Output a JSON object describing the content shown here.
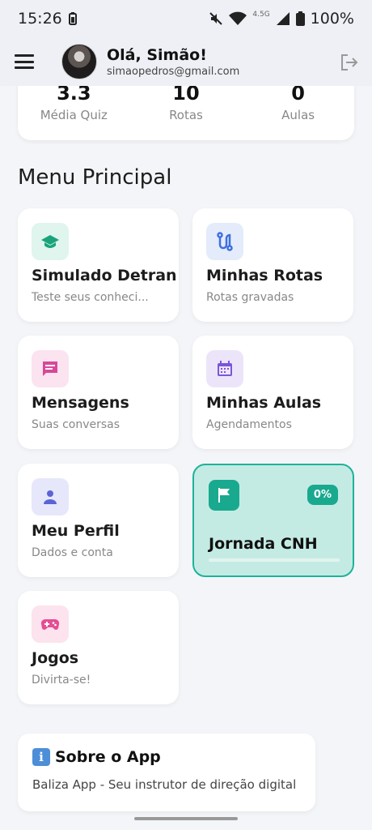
{
  "status_bar": {
    "time": "15:26",
    "network": "4.5G",
    "battery": "100%"
  },
  "header": {
    "greeting": "Olá, Simão!",
    "email": "simaopedros@gmail.com"
  },
  "stats": [
    {
      "value": "3.3",
      "label": "Média Quiz"
    },
    {
      "value": "10",
      "label": "Rotas"
    },
    {
      "value": "0",
      "label": "Aulas"
    }
  ],
  "section_title": "Menu Principal",
  "cards": [
    {
      "title": "Simulado Detran",
      "sub": "Teste seus conheci...",
      "icon": "graduation-cap-icon",
      "color": "#1aa37a",
      "bg": "#dff5ee"
    },
    {
      "title": "Minhas Rotas",
      "sub": "Rotas gravadas",
      "icon": "route-icon",
      "color": "#3f6fe0",
      "bg": "#e4ecfb"
    },
    {
      "title": "Mensagens",
      "sub": "Suas conversas",
      "icon": "message-icon",
      "color": "#d7489a",
      "bg": "#fbe3f0"
    },
    {
      "title": "Minhas Aulas",
      "sub": "Agendamentos",
      "icon": "calendar-icon",
      "color": "#7c56d8",
      "bg": "#ece5fa"
    },
    {
      "title": "Meu Perfil",
      "sub": "Dados e conta",
      "icon": "person-icon",
      "color": "#5a64d6",
      "bg": "#e6e7fb"
    },
    {
      "title": "Jogos",
      "sub": "Divirta-se!",
      "icon": "gamepad-icon",
      "color": "#e44e93",
      "bg": "#fce3ee"
    }
  ],
  "jornada": {
    "title": "Jornada CNH",
    "percent": "0%",
    "progress": 0
  },
  "about": {
    "title": "Sobre o App",
    "subtitle": "Baliza App - Seu instrutor de direção digital"
  }
}
